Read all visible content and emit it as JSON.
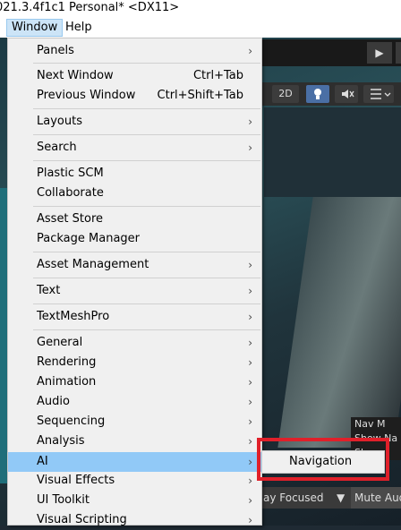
{
  "title": "021.3.4f1c1 Personal* <DX11>",
  "menubar": {
    "window": "Window",
    "help": "Help"
  },
  "scene": {
    "btn_2d": "2D",
    "nav_lines": [
      "Nav M",
      "Show Na",
      "Show"
    ],
    "focus": "ay Focused",
    "mute": "Mute Audi"
  },
  "menu": {
    "items": [
      {
        "label": "Panels",
        "submenu": true
      },
      {
        "label": "Next Window",
        "shortcut": "Ctrl+Tab"
      },
      {
        "label": "Previous Window",
        "shortcut": "Ctrl+Shift+Tab"
      },
      {
        "label": "Layouts",
        "submenu": true
      },
      {
        "label": "Search",
        "submenu": true
      },
      {
        "label": "Plastic SCM"
      },
      {
        "label": "Collaborate"
      },
      {
        "label": "Asset Store"
      },
      {
        "label": "Package Manager"
      },
      {
        "label": "Asset Management",
        "submenu": true
      },
      {
        "label": "Text",
        "submenu": true
      },
      {
        "label": "TextMeshPro",
        "submenu": true
      },
      {
        "label": "General",
        "submenu": true
      },
      {
        "label": "Rendering",
        "submenu": true
      },
      {
        "label": "Animation",
        "submenu": true
      },
      {
        "label": "Audio",
        "submenu": true
      },
      {
        "label": "Sequencing",
        "submenu": true
      },
      {
        "label": "Analysis",
        "submenu": true
      },
      {
        "label": "AI",
        "submenu": true,
        "selected": true
      },
      {
        "label": "Visual Effects",
        "submenu": true
      },
      {
        "label": "UI Toolkit",
        "submenu": true
      },
      {
        "label": "Visual Scripting",
        "submenu": true
      }
    ],
    "chevron": "›"
  },
  "submenu": {
    "navigation": "Navigation"
  },
  "icons": {
    "play": "▶"
  },
  "colors": {
    "selected_item": "#91c9f7",
    "highlight_frame": "#e0202a"
  }
}
